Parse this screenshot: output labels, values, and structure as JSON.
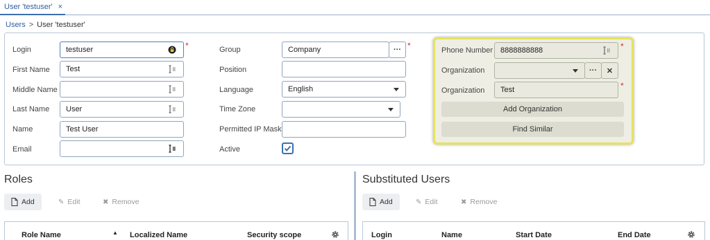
{
  "tab": {
    "title": "User 'testuser'",
    "close": "×"
  },
  "breadcrumb": {
    "parent": "Users",
    "separator": ">",
    "current": "User 'testuser'"
  },
  "form": {
    "login": {
      "label": "Login",
      "value": "testuser"
    },
    "first_name": {
      "label": "First Name",
      "value": "Test"
    },
    "middle_name": {
      "label": "Middle Name",
      "value": ""
    },
    "last_name": {
      "label": "Last Name",
      "value": "User"
    },
    "name": {
      "label": "Name",
      "value": "Test User"
    },
    "email": {
      "label": "Email",
      "value": ""
    },
    "group": {
      "label": "Group",
      "value": "Company",
      "picker": "···"
    },
    "position": {
      "label": "Position",
      "value": ""
    },
    "language": {
      "label": "Language",
      "value": "English"
    },
    "time_zone": {
      "label": "Time Zone",
      "value": ""
    },
    "permitted_ip": {
      "label": "Permitted IP Mask",
      "value": ""
    },
    "active": {
      "label": "Active",
      "checked": true
    },
    "required_mark": "*"
  },
  "panel": {
    "phone": {
      "label": "Phone Number",
      "value": "8888888888"
    },
    "organization_select": {
      "label": "Organization",
      "value": "",
      "picker": "···",
      "clear": "✕"
    },
    "organization_text": {
      "label": "Organization",
      "value": "Test"
    },
    "add_org_button": "Add Organization",
    "find_similar_button": "Find Similar"
  },
  "roles": {
    "title": "Roles",
    "add": "Add",
    "edit": "Edit",
    "remove": "Remove",
    "columns": [
      "Role Name",
      "Localized Name",
      "Security scope"
    ],
    "sort_indicator": "▲"
  },
  "substituted": {
    "title": "Substituted Users",
    "add": "Add",
    "edit": "Edit",
    "remove": "Remove",
    "columns": [
      "Login",
      "Name",
      "Start Date",
      "End Date"
    ]
  },
  "colors": {
    "accent": "#3b6fb0",
    "required": "#d32f2f",
    "highlight_border": "#e6e35a",
    "panel_bg": "#eeeee4"
  },
  "icons": {
    "lock": "lock-icon",
    "text_cursor": "text-cursor-icon",
    "gear": "gear-icon",
    "file": "file-icon",
    "pencil": "pencil-icon",
    "cross": "cross-icon"
  }
}
